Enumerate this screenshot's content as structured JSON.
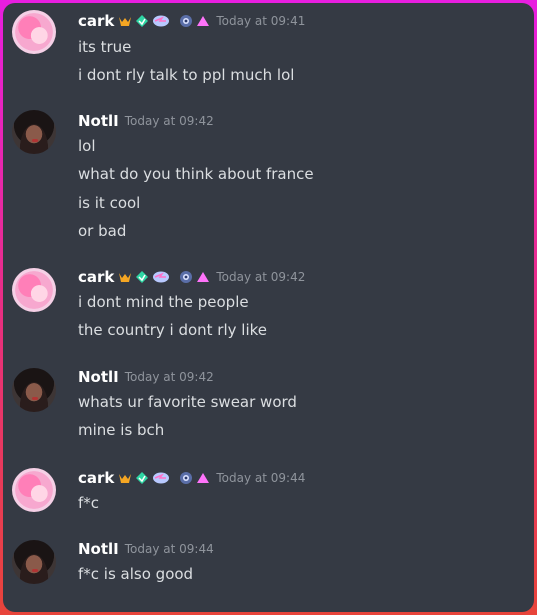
{
  "messages": [
    {
      "author": "cark",
      "time": "Today at 09:41",
      "lines": [
        "its true",
        "i dont rly talk to ppl much lol"
      ]
    },
    {
      "author": "NotlI",
      "time": "Today at 09:42",
      "lines": [
        "lol",
        "what do you think about france",
        "is it cool",
        "or bad"
      ]
    },
    {
      "author": "cark",
      "time": "Today at 09:42",
      "lines": [
        "i dont mind the people",
        "the country i dont rly like"
      ]
    },
    {
      "author": "NotlI",
      "time": "Today at 09:42",
      "lines": [
        "whats ur favorite swear word",
        "mine is bch"
      ]
    },
    {
      "author": "cark",
      "time": "Today at 09:44",
      "lines": [
        "f*c"
      ]
    },
    {
      "author": "NotlI",
      "time": "Today at 09:44",
      "lines": [
        "f*c is also good"
      ]
    }
  ],
  "badges": [
    "hypesquad-icon",
    "gem-icon",
    "nitro-icon",
    "boost-icon",
    "triangle-icon"
  ],
  "colors": {
    "background": "#353a44",
    "text": "#dbdee1",
    "username": "#ffffff",
    "timestamp": "#8f949c"
  }
}
